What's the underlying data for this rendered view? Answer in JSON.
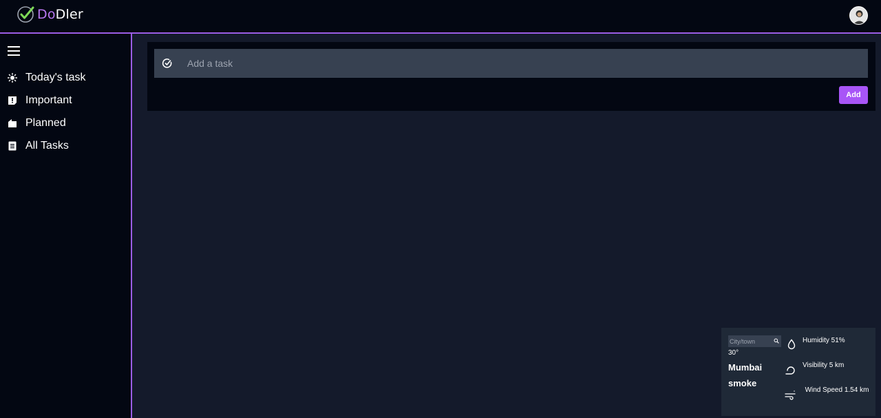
{
  "app": {
    "logo_part1": "Do",
    "logo_part2": "Dler"
  },
  "sidebar": {
    "items": [
      {
        "label": "Today's task",
        "icon": "sun-icon"
      },
      {
        "label": "Important",
        "icon": "important-icon"
      },
      {
        "label": "Planned",
        "icon": "planned-icon"
      },
      {
        "label": "All Tasks",
        "icon": "list-icon"
      }
    ]
  },
  "task_input": {
    "placeholder": "Add a task",
    "add_label": "Add"
  },
  "weather": {
    "search_placeholder": "City/town",
    "temperature": "30°",
    "city": "Mumbai",
    "condition": "smoke",
    "humidity": "Humidity 51%",
    "visibility": "Visibility 5 km",
    "wind_speed": "Wind Speed 1.54 km"
  },
  "colors": {
    "accent": "#a855f7",
    "border": "#9b5de5",
    "background": "#141a2b",
    "panel": "#030712"
  }
}
